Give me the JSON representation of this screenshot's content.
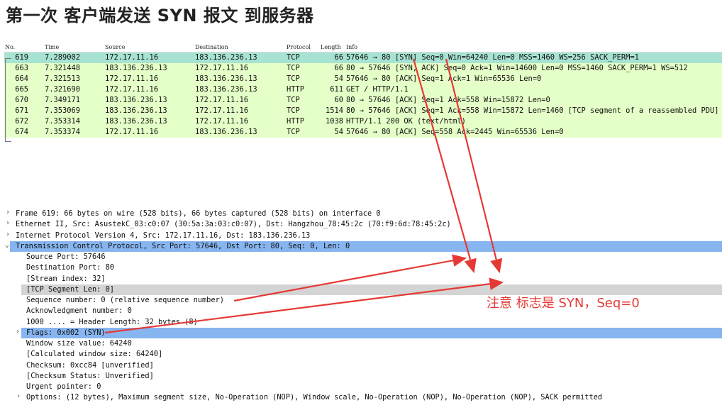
{
  "title": "第一次 客户端发送 SYN 报文 到服务器",
  "packet_list": {
    "columns": [
      "No.",
      "Time",
      "Source",
      "Destination",
      "Protocol",
      "Length",
      "Info"
    ],
    "rows": [
      {
        "no": "619",
        "time": "7.289002",
        "src": "172.17.11.16",
        "dst": "183.136.236.13",
        "proto": "TCP",
        "len": "66",
        "info": "57646 → 80 [SYN] Seq=0 Win=64240 Len=0 MSS=1460 WS=256 SACK_PERM=1",
        "selected": true
      },
      {
        "no": "663",
        "time": "7.321448",
        "src": "183.136.236.13",
        "dst": "172.17.11.16",
        "proto": "TCP",
        "len": "66",
        "info": "80 → 57646 [SYN, ACK] Seq=0 Ack=1 Win=14600 Len=0 MSS=1460 SACK_PERM=1 WS=512"
      },
      {
        "no": "664",
        "time": "7.321513",
        "src": "172.17.11.16",
        "dst": "183.136.236.13",
        "proto": "TCP",
        "len": "54",
        "info": "57646 → 80 [ACK] Seq=1 Ack=1 Win=65536 Len=0"
      },
      {
        "no": "665",
        "time": "7.321690",
        "src": "172.17.11.16",
        "dst": "183.136.236.13",
        "proto": "HTTP",
        "len": "611",
        "info": "GET / HTTP/1.1"
      },
      {
        "no": "670",
        "time": "7.349171",
        "src": "183.136.236.13",
        "dst": "172.17.11.16",
        "proto": "TCP",
        "len": "60",
        "info": "80 → 57646 [ACK] Seq=1 Ack=558 Win=15872 Len=0"
      },
      {
        "no": "671",
        "time": "7.353069",
        "src": "183.136.236.13",
        "dst": "172.17.11.16",
        "proto": "TCP",
        "len": "1514",
        "info": "80 → 57646 [ACK] Seq=1 Ack=558 Win=15872 Len=1460 [TCP segment of a reassembled PDU]"
      },
      {
        "no": "672",
        "time": "7.353314",
        "src": "183.136.236.13",
        "dst": "172.17.11.16",
        "proto": "HTTP",
        "len": "1038",
        "info": "HTTP/1.1 200 OK  (text/html)"
      },
      {
        "no": "674",
        "time": "7.353374",
        "src": "172.17.11.16",
        "dst": "183.136.236.13",
        "proto": "TCP",
        "len": "54",
        "info": "57646 → 80 [ACK] Seq=558 Ack=2445 Win=65536 Len=0"
      }
    ]
  },
  "details": [
    {
      "text": "Frame 619: 66 bytes on wire (528 bits), 66 bytes captured (528 bits) on interface 0",
      "expander": "›",
      "style": "top"
    },
    {
      "text": "Ethernet II, Src: AsustekC_03:c0:07 (30:5a:3a:03:c0:07), Dst: Hangzhou_78:45:2c (70:f9:6d:78:45:2c)",
      "expander": "›",
      "style": "top"
    },
    {
      "text": "Internet Protocol Version 4, Src: 172.17.11.16, Dst: 183.136.236.13",
      "expander": "›",
      "style": "top"
    },
    {
      "text": "Transmission Control Protocol, Src Port: 57646, Dst Port: 80, Seq: 0, Len: 0",
      "expander": "⌄",
      "style": "blue"
    },
    {
      "text": "Source Port: 57646",
      "style": "child"
    },
    {
      "text": "Destination Port: 80",
      "style": "child"
    },
    {
      "text": "[Stream index: 32]",
      "style": "child"
    },
    {
      "text": "[TCP Segment Len: 0]",
      "style": "gray"
    },
    {
      "text": "Sequence number: 0    (relative sequence number)",
      "style": "child"
    },
    {
      "text": "Acknowledgment number: 0",
      "style": "child"
    },
    {
      "text": "1000 .... = Header Length: 32 bytes (8)",
      "style": "child"
    },
    {
      "text": "Flags: 0x002 (SYN)",
      "expander": "›",
      "style": "blue2"
    },
    {
      "text": "Window size value: 64240",
      "style": "child"
    },
    {
      "text": "[Calculated window size: 64240]",
      "style": "child"
    },
    {
      "text": "Checksum: 0xcc84 [unverified]",
      "style": "child"
    },
    {
      "text": "[Checksum Status: Unverified]",
      "style": "child"
    },
    {
      "text": "Urgent pointer: 0",
      "style": "child"
    },
    {
      "text": "Options: (12 bytes), Maximum segment size, No-Operation (NOP), Window scale, No-Operation (NOP), No-Operation (NOP), SACK permitted",
      "expander": "›",
      "style": "childexp"
    }
  ],
  "annotation": "注意 标志是 SYN，Seq=0",
  "colors": {
    "selected_row": "#a7e3d2",
    "tcp_row": "#e4ffc7",
    "detail_highlight": "#87b5f0",
    "arrow": "#e53935"
  }
}
